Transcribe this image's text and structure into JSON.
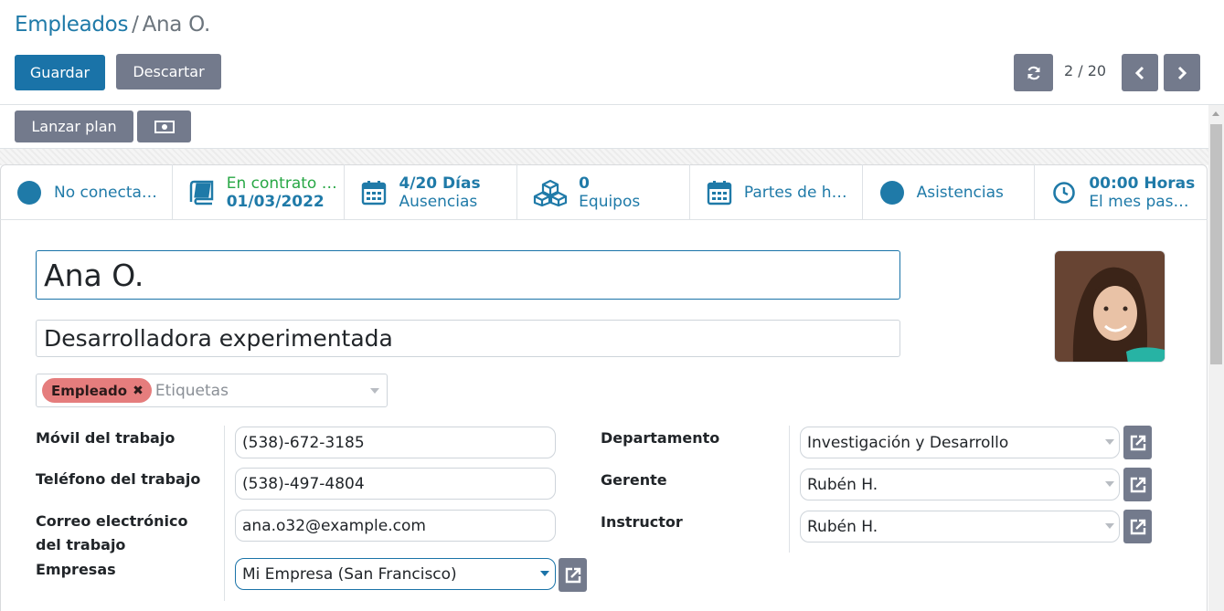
{
  "breadcrumb": {
    "parent": "Empleados",
    "separator": "/",
    "current": "Ana O."
  },
  "actions": {
    "save": "Guardar",
    "discard": "Descartar"
  },
  "pager": {
    "value": "2 / 20"
  },
  "statusbar": {
    "launch_plan": "Lanzar plan"
  },
  "smart_buttons": {
    "presence": {
      "label": "No conecta…"
    },
    "contract": {
      "line1": "En contrato …",
      "line2": "01/03/2022"
    },
    "absences": {
      "line1": "4/20 Días",
      "line2": "Ausencias"
    },
    "equipment": {
      "line1": "0",
      "line2": "Equipos"
    },
    "timesheets": {
      "label": "Partes de h…"
    },
    "attendance": {
      "label": "Asistencias"
    },
    "hours": {
      "line1": "00:00 Horas",
      "line2": "El mes pas…"
    }
  },
  "employee": {
    "name": "Ana O.",
    "job_title": "Desarrolladora experimentada",
    "tag": "Empleado",
    "tags_placeholder": "Etiquetas"
  },
  "left_fields": {
    "mobile_label": "Móvil del trabajo",
    "mobile": "(538)-672-3185",
    "phone_label": "Teléfono del trabajo",
    "phone": "(538)-497-4804",
    "email_label_1": "Correo electrónico",
    "email_label_2": "del trabajo",
    "email": "ana.o32@example.com",
    "company_label": "Empresas",
    "company": "Mi Empresa (San Francisco)"
  },
  "right_fields": {
    "department_label": "Departamento",
    "department": "Investigación y Desarrollo",
    "manager_label": "Gerente",
    "manager": "Rubén H.",
    "coach_label": "Instructor",
    "coach": "Rubén H."
  },
  "colors": {
    "primary": "#1a73a8",
    "secondary": "#737a8c",
    "success": "#28a745",
    "tag": "#e57d7d"
  }
}
